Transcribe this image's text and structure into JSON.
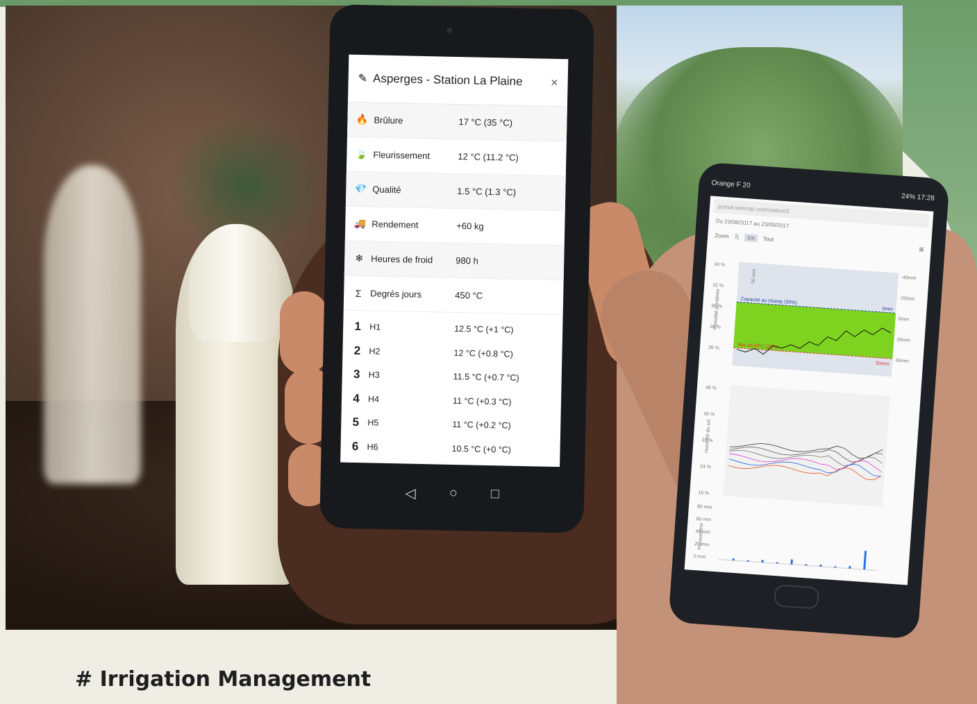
{
  "caption": "# Irrigation Management",
  "phone1": {
    "title": "Asperges - Station La Plaine",
    "close": "×",
    "rows": [
      {
        "icon": "flame-icon",
        "glyph": "🔥",
        "label": "Brûlure",
        "value": "17 °C (35 °C)"
      },
      {
        "icon": "leaf-icon",
        "glyph": "🍃",
        "label": "Fleurissement",
        "value": "12 °C (11.2 °C)"
      },
      {
        "icon": "diamond-icon",
        "glyph": "💎",
        "label": "Qualité",
        "value": "1.5 °C (1.3 °C)"
      },
      {
        "icon": "truck-icon",
        "glyph": "🚚",
        "label": "Rendement",
        "value": "+60 kg"
      },
      {
        "icon": "snowflake-icon",
        "glyph": "❄",
        "label": "Heures de froid",
        "value": "980 h"
      },
      {
        "icon": "sigma-icon",
        "glyph": "Σ",
        "label": "Degrés jours",
        "value": "450 °C"
      }
    ],
    "hours": [
      {
        "glyph": "1",
        "label": "H1",
        "value": "12.5 °C (+1 °C)"
      },
      {
        "glyph": "2",
        "label": "H2",
        "value": "12 °C (+0.8 °C)"
      },
      {
        "glyph": "3",
        "label": "H3",
        "value": "11.5 °C (+0.7 °C)"
      },
      {
        "glyph": "4",
        "label": "H4",
        "value": "11 °C (+0.3 °C)"
      },
      {
        "glyph": "5",
        "label": "H5",
        "value": "11 °C (+0.2 °C)"
      },
      {
        "glyph": "6",
        "label": "H6",
        "value": "10.5 °C (+0 °C)"
      }
    ],
    "nav": [
      "◁",
      "○",
      "□"
    ]
  },
  "phone2": {
    "carrier": "Orange F 20",
    "status": "24% 17:28",
    "url": "portail.sencrop.com/station/3",
    "date_range": "Du 23/08/2017 au 23/09/2017",
    "zoom_label": "Zoom",
    "zoom_options": [
      "7j",
      "1m",
      "Tout"
    ],
    "zoom_selected": "1m",
    "chart1": {
      "ylabel": "Humidité pondérée",
      "yticks": [
        "34 %",
        "32 %",
        "30 %",
        "28 %",
        "26 %"
      ],
      "y2ticks": [
        "-40mm",
        "-20mm",
        "0mm",
        "20mm",
        "40mm"
      ],
      "capacity_label": "Capacité au champ (30%)",
      "capacity_mm": "0mm",
      "refill_label": "Bas de RFU (25%)",
      "refill_mm": "50mm",
      "band_label": "50 mm",
      "series_y": [
        25.6,
        25.4,
        25.8,
        25.3,
        26.2,
        26.0,
        26.4,
        26.1,
        26.8,
        26.5,
        27.4,
        27.1,
        28.1,
        27.6,
        28.3,
        27.9,
        28.6,
        28.2
      ]
    },
    "chart2": {
      "ylabel": "Humidité du sol",
      "yticks": [
        "48 %",
        "40 %",
        "32 %",
        "24 %",
        "16 %"
      ]
    },
    "chart3": {
      "ylabel": "Pluviométrie",
      "yticks": [
        "80 mm",
        "60 mm",
        "40 mm",
        "20 mm",
        "0 mm"
      ],
      "bars": [
        3,
        2,
        4,
        2,
        8,
        2,
        3,
        2,
        4,
        30
      ]
    }
  },
  "colors": {
    "accent": "#6a9a68",
    "band": "#7ed321",
    "capacity": "#1f3fa8",
    "refill": "#e0362b"
  }
}
